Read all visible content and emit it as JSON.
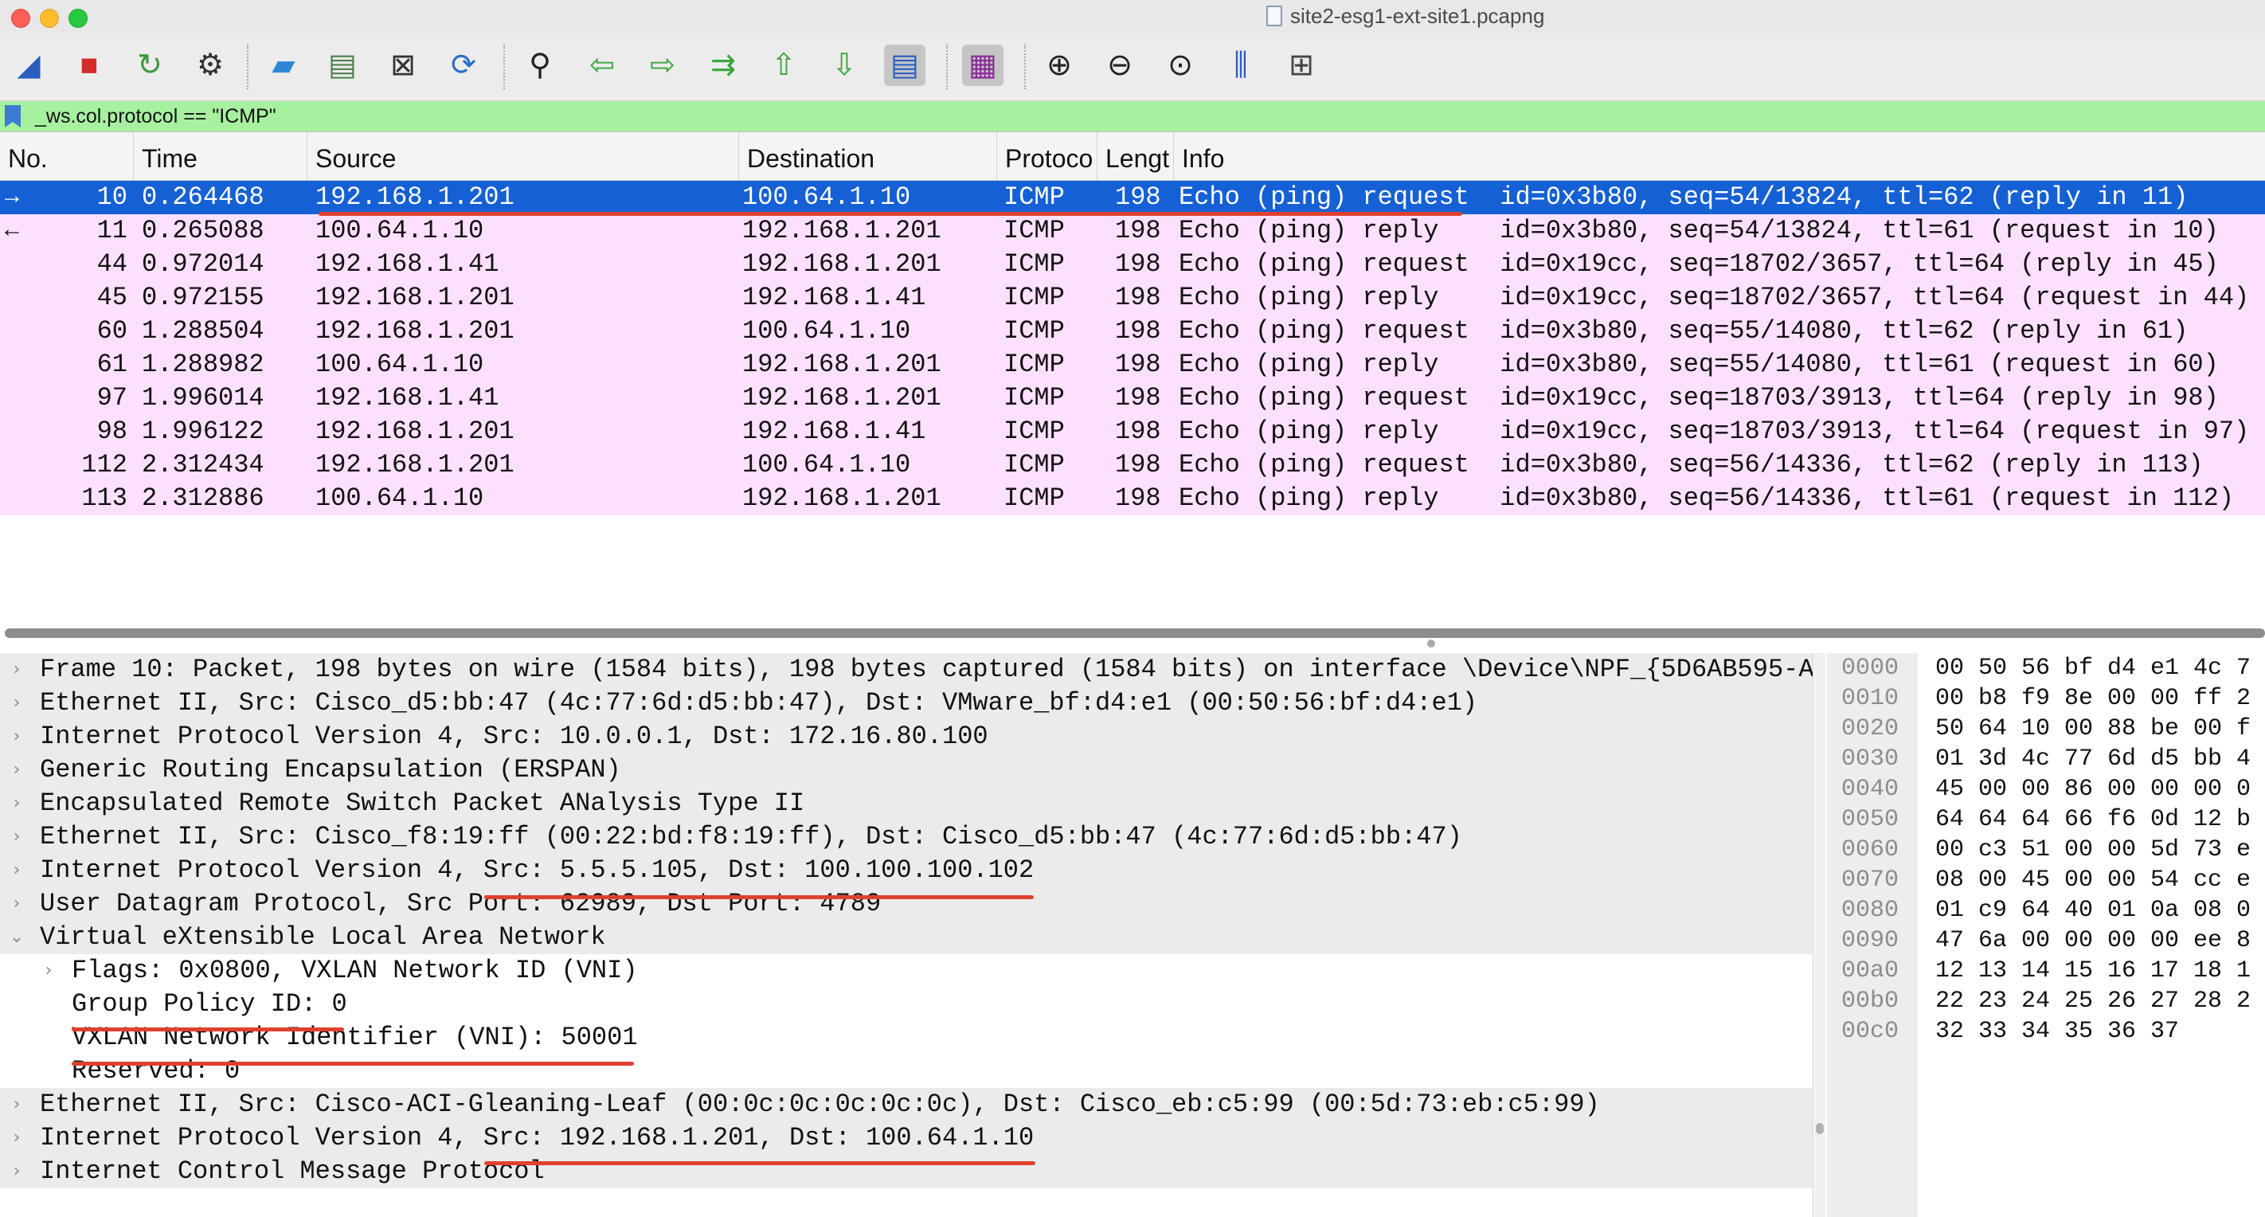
{
  "window": {
    "title": "site2-esg1-ext-site1.pcapng"
  },
  "toolbar": {
    "buttons": [
      {
        "icon": "shark-fin-start-icon",
        "glyph": "◢",
        "color": "#2a5dbf"
      },
      {
        "icon": "stop-capture-icon",
        "glyph": "■",
        "color": "#d62a2a"
      },
      {
        "icon": "restart-capture-icon",
        "glyph": "↻",
        "color": "#3a9a3a"
      },
      {
        "icon": "capture-options-gear-icon",
        "glyph": "⚙",
        "color": "#333333"
      },
      {
        "icon": "open-folder-icon",
        "glyph": "▰",
        "color": "#2f86d6"
      },
      {
        "icon": "save-file-icon",
        "glyph": "▤",
        "color": "#4f7f4f"
      },
      {
        "icon": "close-file-icon",
        "glyph": "⊠",
        "color": "#333333"
      },
      {
        "icon": "reload-file-icon",
        "glyph": "⟳",
        "color": "#2a6fc9"
      },
      {
        "icon": "find-packet-icon",
        "glyph": "⚲",
        "color": "#222222"
      },
      {
        "icon": "go-back-icon",
        "glyph": "⇦",
        "color": "#3aa53a"
      },
      {
        "icon": "go-forward-icon",
        "glyph": "⇨",
        "color": "#3aa53a"
      },
      {
        "icon": "go-to-packet-icon",
        "glyph": "⇉",
        "color": "#3aa53a"
      },
      {
        "icon": "first-packet-icon",
        "glyph": "⇧",
        "color": "#3aa53a"
      },
      {
        "icon": "last-packet-icon",
        "glyph": "⇩",
        "color": "#3aa53a"
      },
      {
        "icon": "auto-scroll-icon",
        "glyph": "▤",
        "color": "#2a5dbf"
      },
      {
        "icon": "colorize-list-icon",
        "glyph": "▦",
        "color": "#8a2a9a"
      },
      {
        "icon": "zoom-in-icon",
        "glyph": "⊕",
        "color": "#222222"
      },
      {
        "icon": "zoom-out-icon",
        "glyph": "⊖",
        "color": "#222222"
      },
      {
        "icon": "normal-size-icon",
        "glyph": "⊙",
        "color": "#222222"
      },
      {
        "icon": "resize-columns-icon",
        "glyph": "⫼",
        "color": "#2a5dbf"
      },
      {
        "icon": "layout-panes-icon",
        "glyph": "⊞",
        "color": "#444444"
      }
    ]
  },
  "filter": {
    "text": "_ws.col.protocol == \"ICMP\""
  },
  "packet_list": {
    "columns": [
      "No.",
      "Time",
      "Source",
      "Destination",
      "Protoco",
      "Lengt",
      "Info"
    ],
    "rows": [
      {
        "no": "10",
        "time": "0.264468",
        "src": "192.168.1.201",
        "dst": "100.64.1.10",
        "proto": "ICMP",
        "len": "198",
        "info": "Echo (ping) request  id=0x3b80, seq=54/13824, ttl=62 (reply in 11)",
        "marker": "→"
      },
      {
        "no": "11",
        "time": "0.265088",
        "src": "100.64.1.10",
        "dst": "192.168.1.201",
        "proto": "ICMP",
        "len": "198",
        "info": "Echo (ping) reply    id=0x3b80, seq=54/13824, ttl=61 (request in 10)",
        "marker": "←"
      },
      {
        "no": "44",
        "time": "0.972014",
        "src": "192.168.1.41",
        "dst": "192.168.1.201",
        "proto": "ICMP",
        "len": "198",
        "info": "Echo (ping) request  id=0x19cc, seq=18702/3657, ttl=64 (reply in 45)",
        "marker": ""
      },
      {
        "no": "45",
        "time": "0.972155",
        "src": "192.168.1.201",
        "dst": "192.168.1.41",
        "proto": "ICMP",
        "len": "198",
        "info": "Echo (ping) reply    id=0x19cc, seq=18702/3657, ttl=64 (request in 44)",
        "marker": ""
      },
      {
        "no": "60",
        "time": "1.288504",
        "src": "192.168.1.201",
        "dst": "100.64.1.10",
        "proto": "ICMP",
        "len": "198",
        "info": "Echo (ping) request  id=0x3b80, seq=55/14080, ttl=62 (reply in 61)",
        "marker": ""
      },
      {
        "no": "61",
        "time": "1.288982",
        "src": "100.64.1.10",
        "dst": "192.168.1.201",
        "proto": "ICMP",
        "len": "198",
        "info": "Echo (ping) reply    id=0x3b80, seq=55/14080, ttl=61 (request in 60)",
        "marker": ""
      },
      {
        "no": "97",
        "time": "1.996014",
        "src": "192.168.1.41",
        "dst": "192.168.1.201",
        "proto": "ICMP",
        "len": "198",
        "info": "Echo (ping) request  id=0x19cc, seq=18703/3913, ttl=64 (reply in 98)",
        "marker": ""
      },
      {
        "no": "98",
        "time": "1.996122",
        "src": "192.168.1.201",
        "dst": "192.168.1.41",
        "proto": "ICMP",
        "len": "198",
        "info": "Echo (ping) reply    id=0x19cc, seq=18703/3913, ttl=64 (request in 97)",
        "marker": ""
      },
      {
        "no": "112",
        "time": "2.312434",
        "src": "192.168.1.201",
        "dst": "100.64.1.10",
        "proto": "ICMP",
        "len": "198",
        "info": "Echo (ping) request  id=0x3b80, seq=56/14336, ttl=62 (reply in 113)",
        "marker": ""
      },
      {
        "no": "113",
        "time": "2.312886",
        "src": "100.64.1.10",
        "dst": "192.168.1.201",
        "proto": "ICMP",
        "len": "198",
        "info": "Echo (ping) reply    id=0x3b80, seq=56/14336, ttl=61 (request in 112)",
        "marker": ""
      }
    ],
    "selected_index": 0
  },
  "details": {
    "rows": [
      {
        "depth": 0,
        "exp": "›",
        "text": "Frame 10: Packet, 198 bytes on wire (1584 bits), 198 bytes captured (1584 bits) on interface \\Device\\NPF_{5D6AB595-A"
      },
      {
        "depth": 0,
        "exp": "›",
        "text": "Ethernet II, Src: Cisco_d5:bb:47 (4c:77:6d:d5:bb:47), Dst: VMware_bf:d4:e1 (00:50:56:bf:d4:e1)"
      },
      {
        "depth": 0,
        "exp": "›",
        "text": "Internet Protocol Version 4, Src: 10.0.0.1, Dst: 172.16.80.100"
      },
      {
        "depth": 0,
        "exp": "›",
        "text": "Generic Routing Encapsulation (ERSPAN)"
      },
      {
        "depth": 0,
        "exp": "›",
        "text": "Encapsulated Remote Switch Packet ANalysis Type II"
      },
      {
        "depth": 0,
        "exp": "›",
        "text": "Ethernet II, Src: Cisco_f8:19:ff (00:22:bd:f8:19:ff), Dst: Cisco_d5:bb:47 (4c:77:6d:d5:bb:47)"
      },
      {
        "depth": 0,
        "exp": "›",
        "text": "Internet Protocol Version 4, Src: 5.5.5.105, Dst: 100.100.100.102"
      },
      {
        "depth": 0,
        "exp": "›",
        "text": "User Datagram Protocol, Src Port: 62989, Dst Port: 4789"
      },
      {
        "depth": 0,
        "exp": "⌄",
        "text": "Virtual eXtensible Local Area Network"
      },
      {
        "depth": 1,
        "exp": "›",
        "text": "Flags: 0x0800, VXLAN Network ID (VNI)"
      },
      {
        "depth": 1,
        "exp": "",
        "text": "Group Policy ID: 0"
      },
      {
        "depth": 1,
        "exp": "",
        "text": "VXLAN Network Identifier (VNI): 50001"
      },
      {
        "depth": 1,
        "exp": "",
        "text": "Reserved: 0"
      },
      {
        "depth": 0,
        "exp": "›",
        "text": "Ethernet II, Src: Cisco-ACI-Gleaning-Leaf (00:0c:0c:0c:0c:0c), Dst: Cisco_eb:c5:99 (00:5d:73:eb:c5:99)"
      },
      {
        "depth": 0,
        "exp": "›",
        "text": "Internet Protocol Version 4, Src: 192.168.1.201, Dst: 100.64.1.10"
      },
      {
        "depth": 0,
        "exp": "›",
        "text": "Internet Control Message Protocol"
      }
    ]
  },
  "hex": {
    "offsets": [
      "0000",
      "0010",
      "0020",
      "0030",
      "0040",
      "0050",
      "0060",
      "0070",
      "0080",
      "0090",
      "00a0",
      "00b0",
      "00c0"
    ],
    "bytes": [
      "00 50 56 bf d4 e1 4c 7",
      "00 b8 f9 8e 00 00 ff 2",
      "50 64 10 00 88 be 00 f",
      "01 3d 4c 77 6d d5 bb 4",
      "45 00 00 86 00 00 00 0",
      "64 64 64 66 f6 0d 12 b",
      "00 c3 51 00 00 5d 73 e",
      "08 00 45 00 00 54 cc e",
      "01 c9 64 40 01 0a 08 0",
      "47 6a 00 00 00 00 ee 8",
      "12 13 14 15 16 17 18 1",
      "22 23 24 25 26 27 28 2",
      "32 33 34 35 36 37"
    ]
  },
  "colors": {
    "selected_row": "#1560d4",
    "icmp_row": "#fde0fd",
    "filter_ok": "#a7f0a0",
    "annotation": "#e0402f"
  }
}
